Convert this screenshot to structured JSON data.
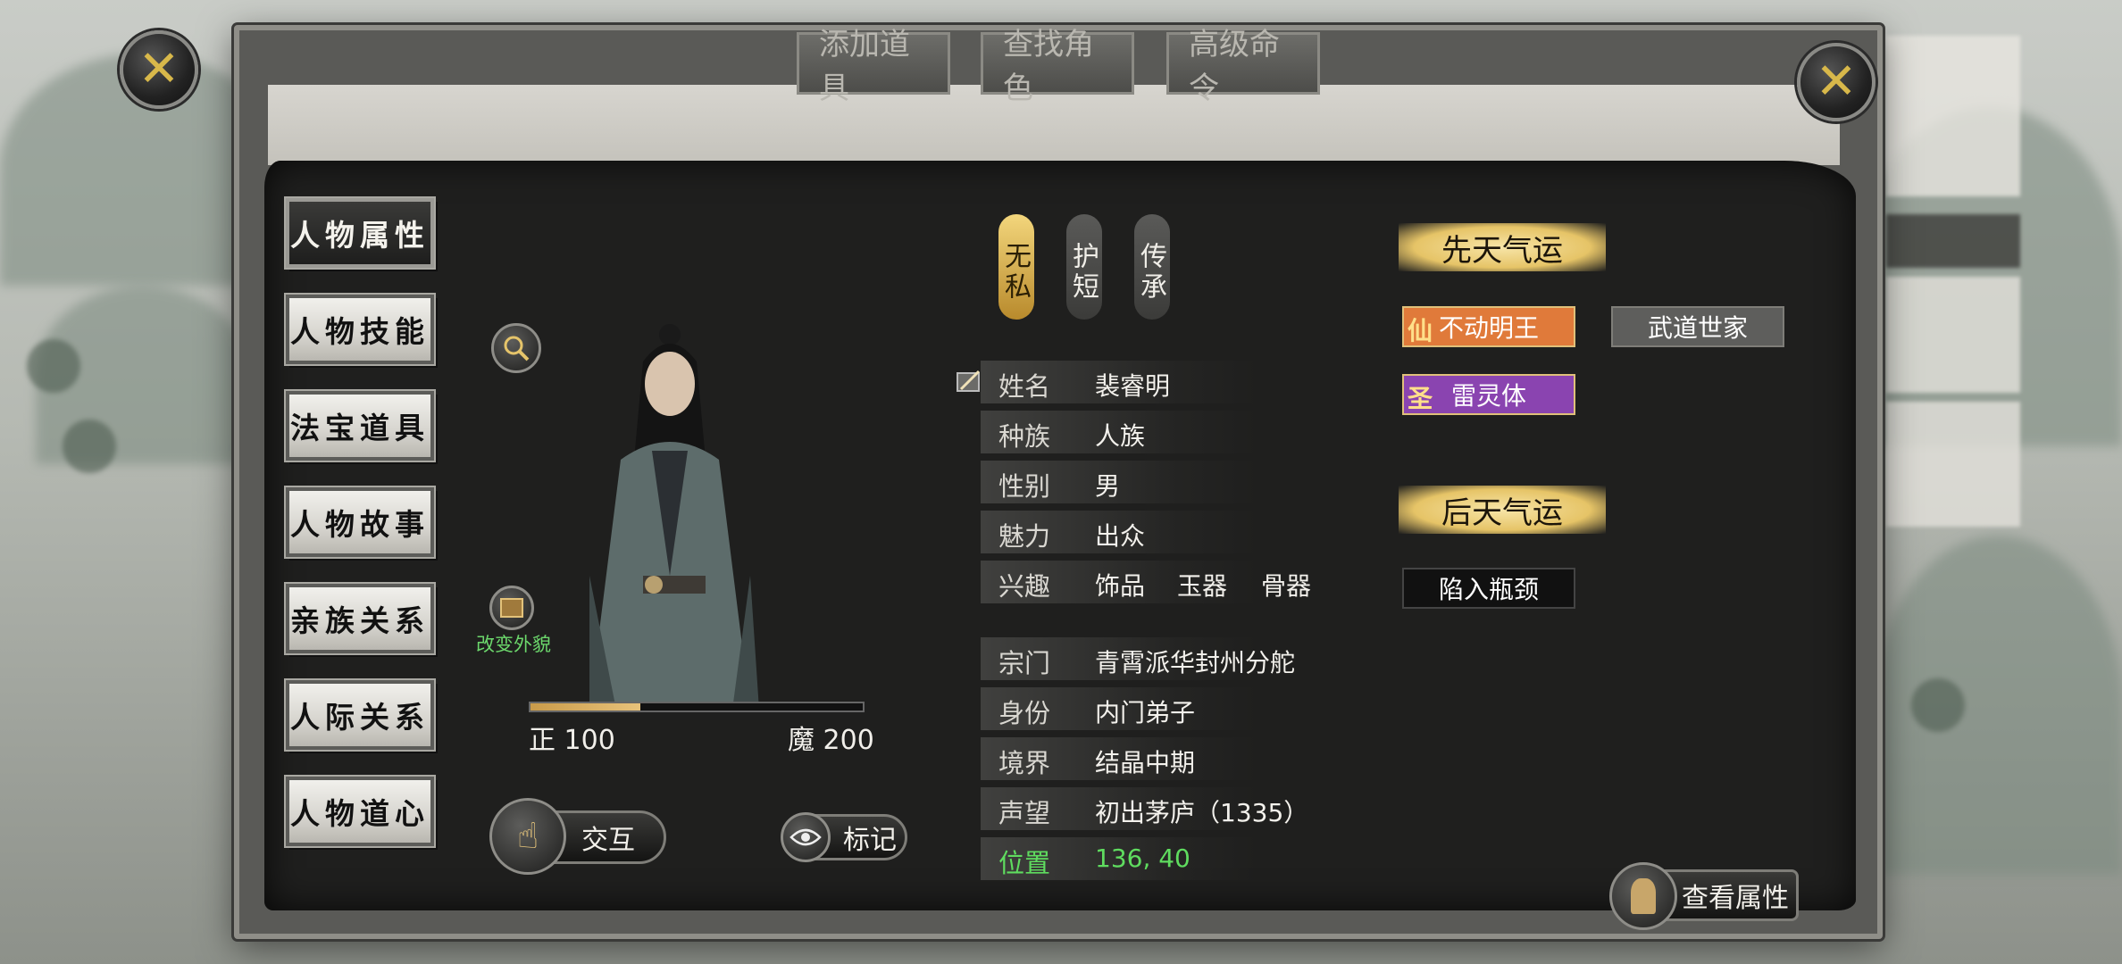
{
  "top_tabs": [
    "添加道具",
    "查找角色",
    "高级命令"
  ],
  "menu": [
    "人物属性",
    "人物技能",
    "法宝道具",
    "人物故事",
    "亲族关系",
    "人际关系",
    "人物道心"
  ],
  "traits": [
    "无私",
    "护短",
    "传承"
  ],
  "info": [
    {
      "label": "姓名",
      "value": "裴睿明"
    },
    {
      "label": "种族",
      "value": "人族"
    },
    {
      "label": "性别",
      "value": "男"
    },
    {
      "label": "魅力",
      "value": "出众"
    },
    {
      "label": "兴趣",
      "values": [
        "饰品",
        "玉器",
        "骨器"
      ]
    }
  ],
  "info2": [
    {
      "label": "宗门",
      "value": "青霄派华封州分舵"
    },
    {
      "label": "身份",
      "value": "内门弟子"
    },
    {
      "label": "境界",
      "value": "结晶中期"
    },
    {
      "label": "声望",
      "value": "初出茅庐（1335）"
    },
    {
      "label": "位置",
      "value": "136, 40"
    }
  ],
  "morality": {
    "left_label": "正 100",
    "right_label": "魔 200",
    "fill_fraction": 0.33
  },
  "change_look_label": "改变外貌",
  "innate": {
    "title": "先天气运",
    "items": [
      {
        "badge": "仙",
        "label": "不动明王",
        "color": "#e07a3a"
      },
      {
        "badge": "",
        "label": "武道世家",
        "color": "#5e5e5c"
      },
      {
        "badge": "圣",
        "label": "雷灵体",
        "color": "#8a44b0"
      }
    ]
  },
  "acquired": {
    "title": "后天气运",
    "items": [
      "陷入瓶颈"
    ]
  },
  "buttons": {
    "interact": "交互",
    "mark": "标记",
    "view_attr": "查看属性"
  }
}
